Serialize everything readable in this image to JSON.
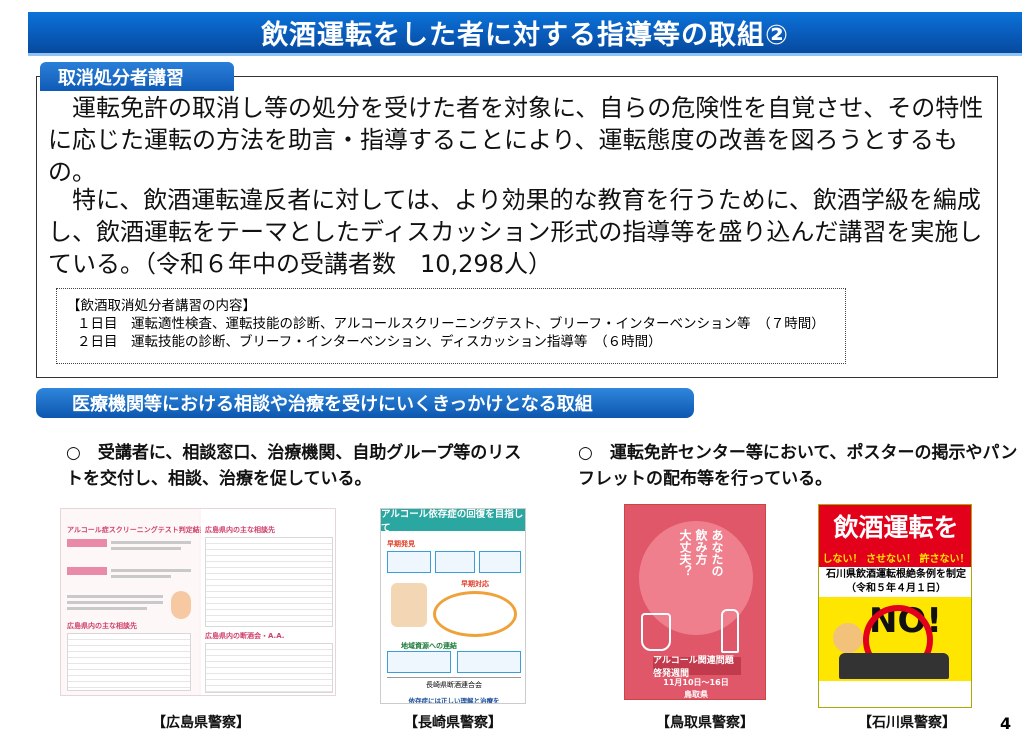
{
  "page": {
    "title": "飲酒運転をした者に対する指導等の取組②",
    "page_number": "4"
  },
  "section1": {
    "tab_label": "取消処分者講習",
    "para1": "　運転免許の取消し等の処分を受けた者を対象に、自らの危険性を自覚させ、その特性に応じた運転の方法を助言・指導することにより、運転態度の改善を図ろうとするもの。",
    "para2": "　特に、飲酒運転違反者に対しては、より効果的な教育を行うために、飲酒学級を編成し、飲酒運転をテーマとしたディスカッション形式の指導等を盛り込んだ講習を実施している。（令和６年中の受講者数　10,298人）",
    "content_box": {
      "heading": "【飲酒取消処分者講習の内容】",
      "day1": "１日目　運転適性検査、運転技能の診断、アルコールスクリーニングテスト、ブリーフ・インターベンション等　（７時間）",
      "day2": "２日目　運転技能の診断、ブリーフ・インターベンション、ディスカッション指導等　（６時間）"
    }
  },
  "section2": {
    "band_label": "医療機関等における相談や治療を受けにいくきっかけとなる取組",
    "bullet_left": "○　受講者に、相談窓口、治療機関、自助グループ等のリストを交付し、相談、治療を促している。",
    "bullet_right": "○　運転免許センター等において、ポスターの掲示やパンフレットの配布等を行っている。"
  },
  "images": {
    "hiroshima": {
      "caption": "【広島県警察】",
      "text_title": "アルコール症スクリーニングテスト判定結果",
      "text_list": "広島県内の主な相談先",
      "text_list2": "広島県内の断酒会・A.A."
    },
    "nagasaki": {
      "caption": "【長崎県警察】",
      "text_title": "アルコール依存症の回復を目指して",
      "text_early": "早期発見",
      "text_early2": "早期対応",
      "text_support": "地域資源への連結",
      "text_org": "長崎県断酒連合会",
      "text_footer": "依存症には正しい理解と治療を"
    },
    "tottori": {
      "caption": "【鳥取県警察】",
      "text_vertical_a": "あなたの",
      "text_vertical_b": "飲み方",
      "text_vertical_c": "大丈夫？",
      "text_strip": "アルコール関連問題啓発週間",
      "text_date": "11月10日～16日",
      "text_org": "鳥取県"
    },
    "ishikawa": {
      "caption": "【石川県警察】",
      "text_headline": "飲酒運転を",
      "text_sub": "しない！ させない！ 許さない！",
      "text_law_a": "石川県飲酒運転根絶条例を制定",
      "text_law_b": "（令和５年４月１日）",
      "text_no": "NO!"
    }
  },
  "colors": {
    "title_blue": "#0a5fc0",
    "band_blue": "#1c6fc8",
    "ishikawa_red": "#e3001b",
    "ishikawa_yellow": "#ffe600",
    "tottori_red": "#e0576a"
  }
}
